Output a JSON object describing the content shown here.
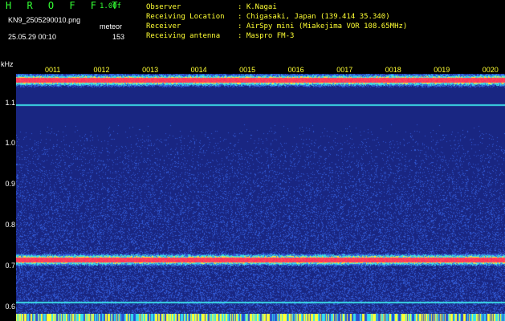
{
  "header": {
    "app_title": "H R O F F T",
    "version": "1.00f",
    "filename": "KN9_2505290010.png",
    "meteor_label": "meteor",
    "datetime": "25.05.29 00:10",
    "meteor_count": "153",
    "info": [
      {
        "label": "Observer",
        "value": ": K.Nagai"
      },
      {
        "label": "Receiving Location",
        "value": ": Chigasaki, Japan (139.414 35.340)"
      },
      {
        "label": "Receiver",
        "value": ": AirSpy mini (Miakejima VOR 108.65MHz)"
      },
      {
        "label": "Receiving antenna",
        "value": ": Maspro FM-3"
      }
    ]
  },
  "chart_data": {
    "type": "heatmap",
    "yunit": "kHz",
    "yticks": [
      "1.1",
      "1.0",
      "0.9",
      "0.8",
      "0.7",
      "0.6"
    ],
    "ylim": [
      0.58,
      1.17
    ],
    "xticks": [
      "0011",
      "0012",
      "0013",
      "0014",
      "0015",
      "0016",
      "0017",
      "0018",
      "0019",
      "0020"
    ],
    "colors": {
      "background": "#1a237e",
      "noise_low": "#2a4fd0",
      "noise_mid": "#2bd3e8",
      "noise_high": "#ffff33",
      "peak": "#ff2255"
    },
    "bands": [
      {
        "freq_khz": 1.155,
        "intensity": "high"
      },
      {
        "freq_khz": 1.095,
        "intensity": "low"
      },
      {
        "freq_khz": 0.715,
        "intensity": "high"
      },
      {
        "freq_khz": 0.61,
        "intensity": "low"
      }
    ]
  }
}
